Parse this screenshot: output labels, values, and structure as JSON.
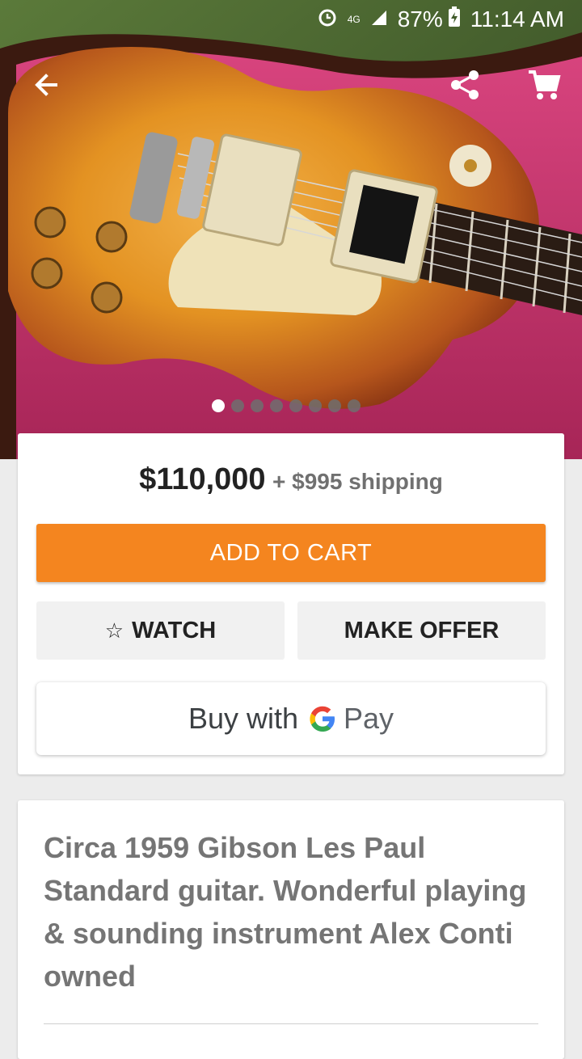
{
  "status_bar": {
    "battery_percent": "87%",
    "time": "11:14 AM",
    "network_label": "4G"
  },
  "app_bar": {
    "icons": [
      "back-arrow-icon",
      "share-icon",
      "cart-icon"
    ]
  },
  "gallery": {
    "image_count": 8,
    "active_index": 0
  },
  "listing": {
    "price": "$110,000",
    "shipping": "+ $995 shipping",
    "add_to_cart_label": "ADD TO CART",
    "watch_label": "WATCH",
    "make_offer_label": "MAKE OFFER",
    "gpay_prefix": "Buy with",
    "gpay_suffix": "Pay",
    "title": "Circa 1959 Gibson Les Paul Standard guitar. Wonderful playing & sounding instrument Alex Conti owned"
  },
  "colors": {
    "accent": "#f4851f",
    "secondary_button": "#f1f1f1",
    "background": "#ececec"
  }
}
